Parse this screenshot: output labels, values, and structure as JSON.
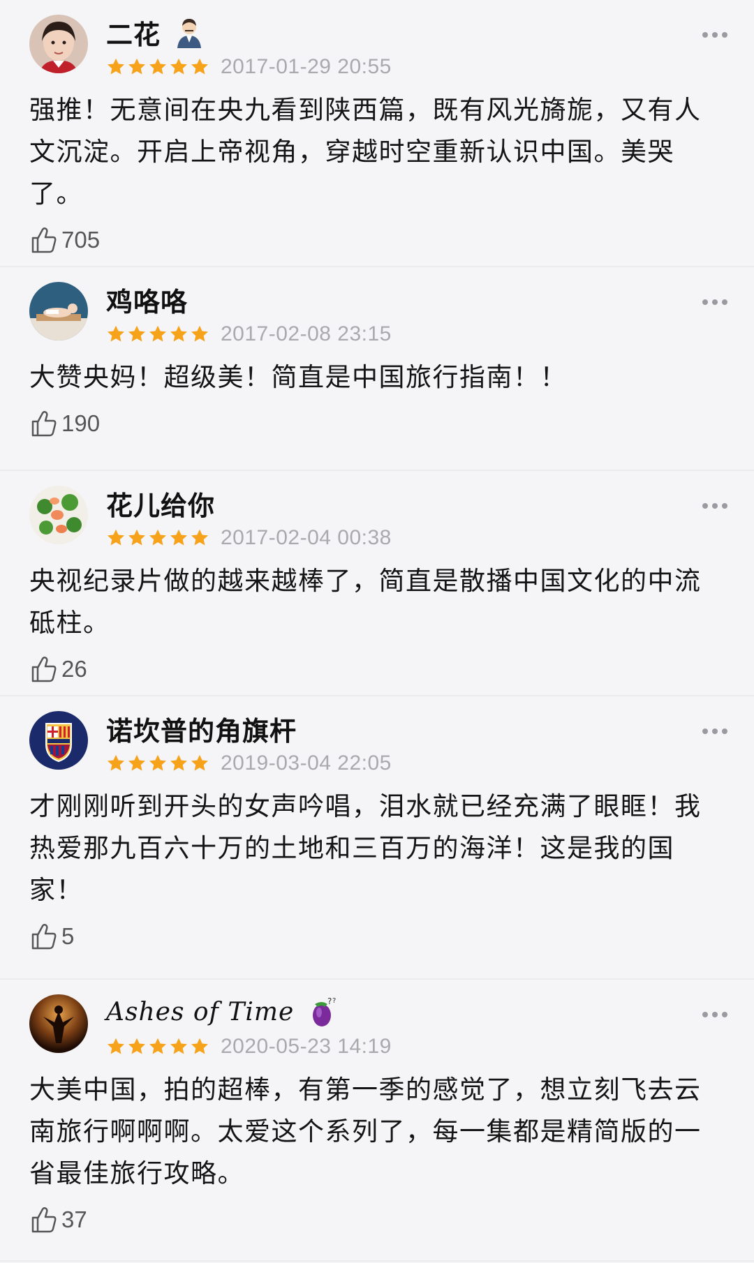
{
  "colors": {
    "star": "#f7a21b",
    "date": "#a9a9ae",
    "background": "#f5f5f7",
    "divider": "#ebebed"
  },
  "reviews": [
    {
      "name": "二花",
      "badge": "man-emoji-icon",
      "stars": 5,
      "date": "2017-01-29 20:55",
      "text": "强推！无意间在央九看到陕西篇，既有风光旖旎，又有人文沉淀。开启上帝视角，穿越时空重新认识中国。美哭了。",
      "likes": "705"
    },
    {
      "name": "鸡咯咯",
      "stars": 5,
      "date": "2017-02-08 23:15",
      "text": "大赞央妈！超级美！简直是中国旅行指南！！",
      "likes": "190"
    },
    {
      "name": "花儿给你",
      "stars": 5,
      "date": "2017-02-04 00:38",
      "text": "央视纪录片做的越来越棒了，简直是散播中国文化的中流砥柱。",
      "likes": "26"
    },
    {
      "name": "诺坎普的角旗杆",
      "stars": 5,
      "date": "2019-03-04 22:05",
      "text": "才刚刚听到开头的女声吟唱，泪水就已经充满了眼眶！我热爱那九百六十万的土地和三百万的海洋！这是我的国家！",
      "likes": "5"
    },
    {
      "name": "Ashes of Time",
      "badge": "eggplant-emoji-icon",
      "stars": 5,
      "date": "2020-05-23 14:19",
      "text": "大美中国，拍的超棒，有第一季的感觉了，想立刻飞去云南旅行啊啊啊。太爱这个系列了，每一集都是精简版的一省最佳旅行攻略。",
      "likes": "37"
    }
  ]
}
